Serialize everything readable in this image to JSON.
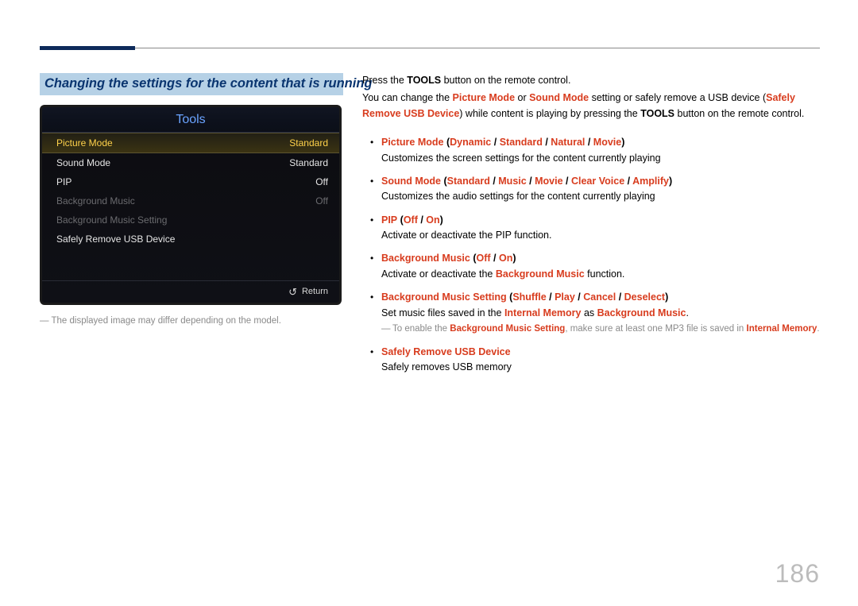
{
  "page_number": "186",
  "heading": "Changing the settings for the content that is running",
  "tv": {
    "title": "Tools",
    "items": [
      {
        "label": "Picture Mode",
        "value": "Standard",
        "state": "selected"
      },
      {
        "label": "Sound Mode",
        "value": "Standard",
        "state": "white"
      },
      {
        "label": "PIP",
        "value": "Off",
        "state": "white"
      },
      {
        "label": "Background Music",
        "value": "Off",
        "state": "dim"
      },
      {
        "label": "Background Music Setting",
        "value": "",
        "state": "dim"
      },
      {
        "label": "Safely Remove USB Device",
        "value": "",
        "state": "white"
      }
    ],
    "return_label": "Return"
  },
  "footnote": "The displayed image may differ depending on the model.",
  "body": {
    "line1_pre": "Press the ",
    "line1_bold": "TOOLS",
    "line1_post": " button on the remote control.",
    "line2_a": "You can change the ",
    "line2_pm": "Picture Mode",
    "line2_or": " or ",
    "line2_sm": "Sound Mode",
    "line2_mid": " setting or safely remove a USB device (",
    "line2_sr": "Safely Remove USB Device",
    "line2_end1": ") while content is playing by pressing the ",
    "line2_tools": "TOOLS",
    "line2_end2": " button on the remote control.",
    "items": {
      "picture": {
        "name": "Picture Mode",
        "opts": [
          "Dynamic",
          "Standard",
          "Natural",
          "Movie"
        ],
        "desc": "Customizes the screen settings for the content currently playing"
      },
      "sound": {
        "name": "Sound Mode",
        "opts": [
          "Standard",
          "Music",
          "Movie",
          "Clear Voice",
          "Amplify"
        ],
        "desc": "Customizes the audio settings for the content currently playing"
      },
      "pip": {
        "name": "PIP",
        "opts": [
          "Off",
          "On"
        ],
        "desc": "Activate or deactivate the PIP function."
      },
      "bgmusic": {
        "name": "Background Music",
        "opts": [
          "Off",
          "On"
        ],
        "desc_a": "Activate or deactivate the ",
        "desc_bold": "Background Music",
        "desc_b": " function."
      },
      "bgset": {
        "name": "Background Music Setting",
        "opts": [
          "Shuffle",
          "Play",
          "Cancel",
          "Deselect"
        ],
        "desc_a": "Set music files saved in the ",
        "desc_im": "Internal Memory",
        "desc_b": " as ",
        "desc_bgm": "Background Music",
        "desc_c": ".",
        "note_a": "To enable the ",
        "note_b": "Background Music Setting",
        "note_c": ", make sure at least one MP3 file is saved in ",
        "note_d": "Internal Memory",
        "note_e": "."
      },
      "safely": {
        "name": "Safely Remove USB Device",
        "desc": "Safely removes USB memory"
      }
    }
  }
}
